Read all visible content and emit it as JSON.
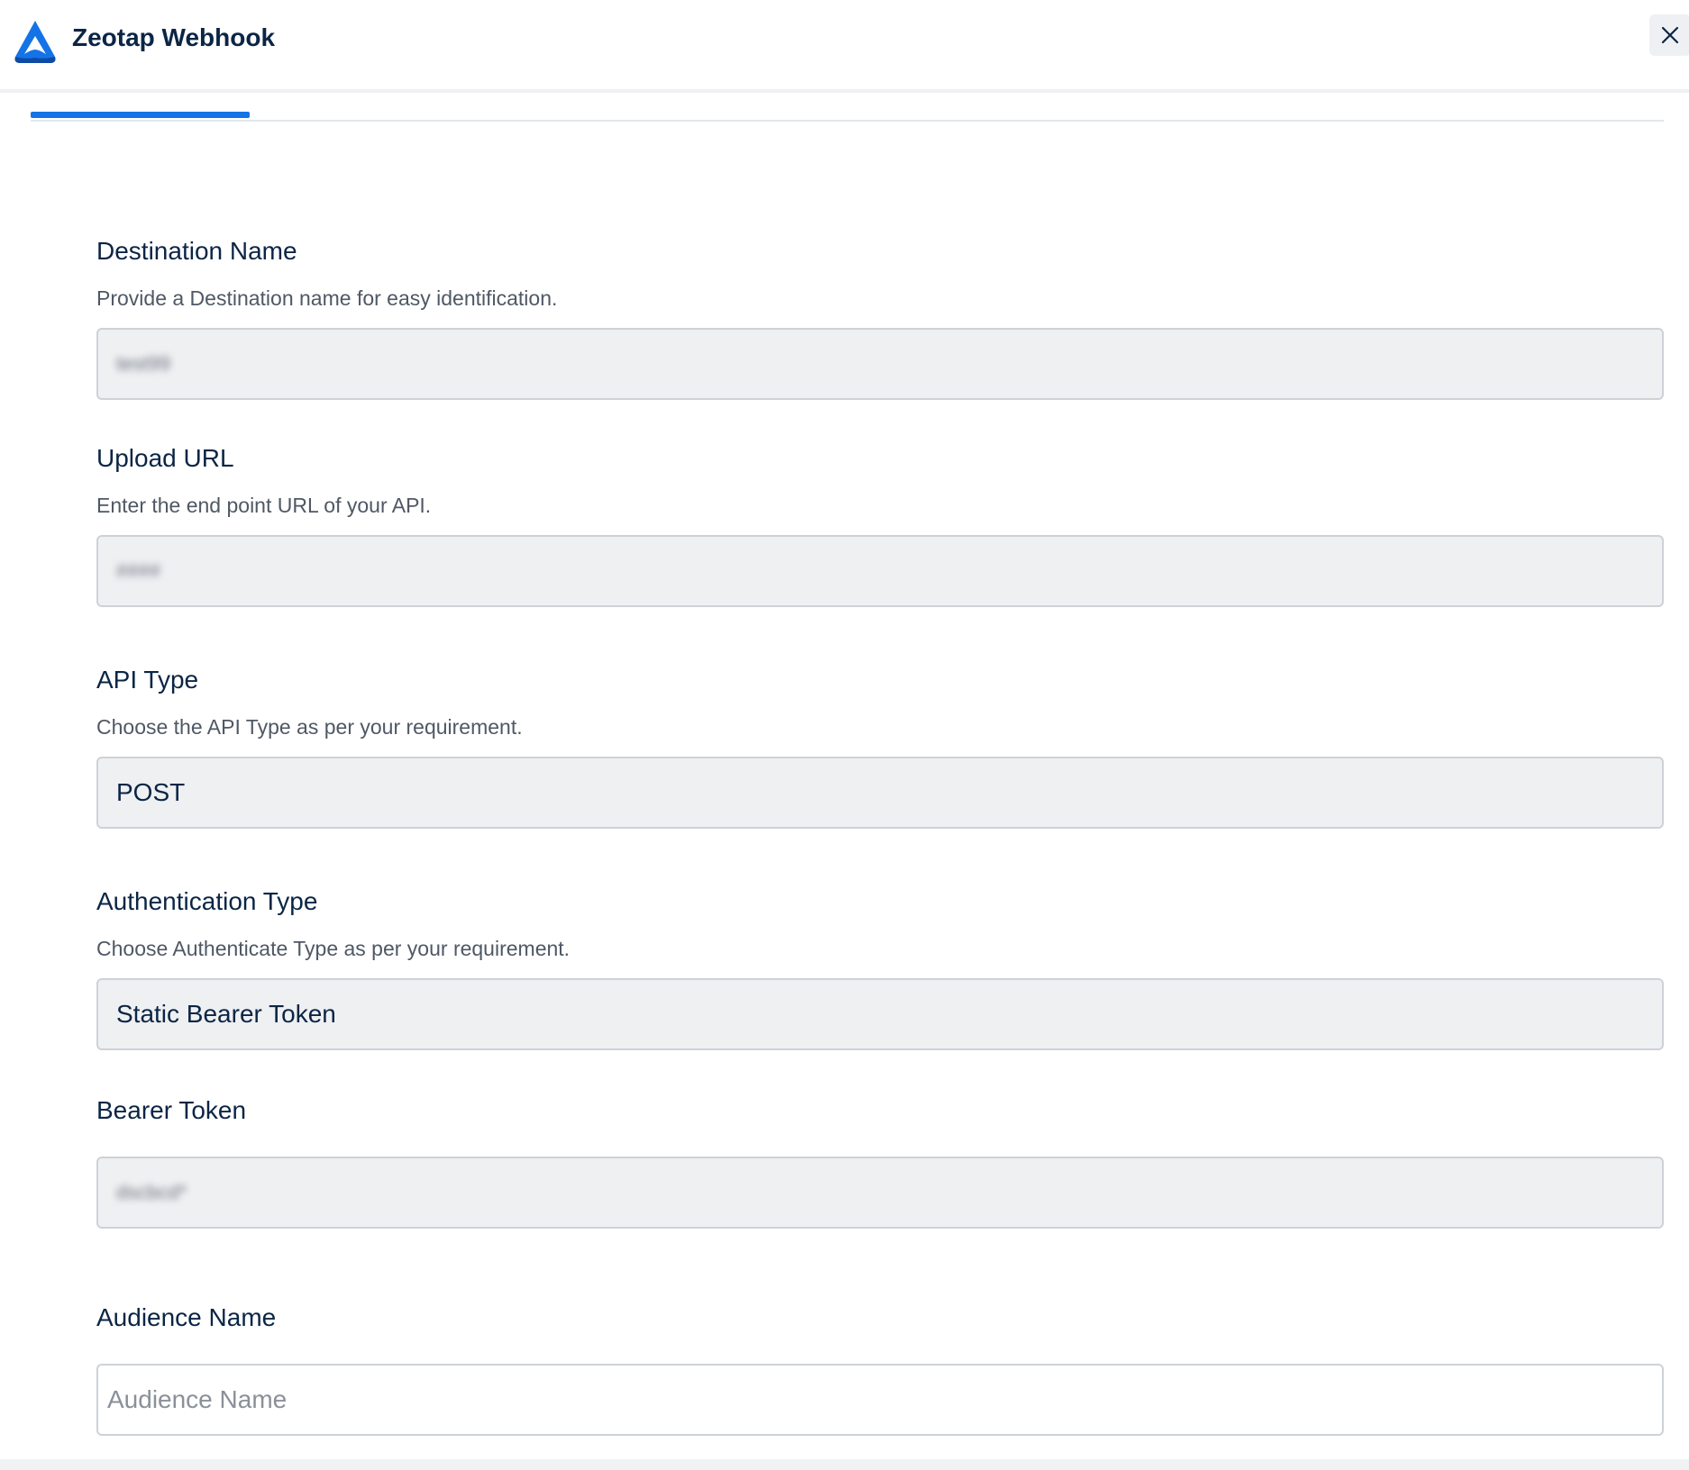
{
  "header": {
    "title": "Zeotap Webhook",
    "logo_icon": "zeotap-logo-icon",
    "close_icon": "close-icon"
  },
  "colors": {
    "accent": "#1473e6",
    "heading": "#0b2545",
    "input_bg": "#eff0f2"
  },
  "fields": {
    "destination_name": {
      "label": "Destination Name",
      "help": "Provide a Destination name for easy identification.",
      "value": "test99"
    },
    "upload_url": {
      "label": "Upload URL",
      "help": "Enter the end point URL of your API.",
      "value": "####"
    },
    "api_type": {
      "label": "API Type",
      "help": "Choose the API Type as per your requirement.",
      "value": "POST"
    },
    "auth_type": {
      "label": "Authentication Type",
      "help": "Choose Authenticate Type as per your requirement.",
      "value": "Static Bearer Token"
    },
    "bearer_token": {
      "label": "Bearer Token",
      "value": "dscbcd*"
    },
    "audience_name": {
      "label": "Audience Name",
      "placeholder": "Audience Name"
    }
  }
}
